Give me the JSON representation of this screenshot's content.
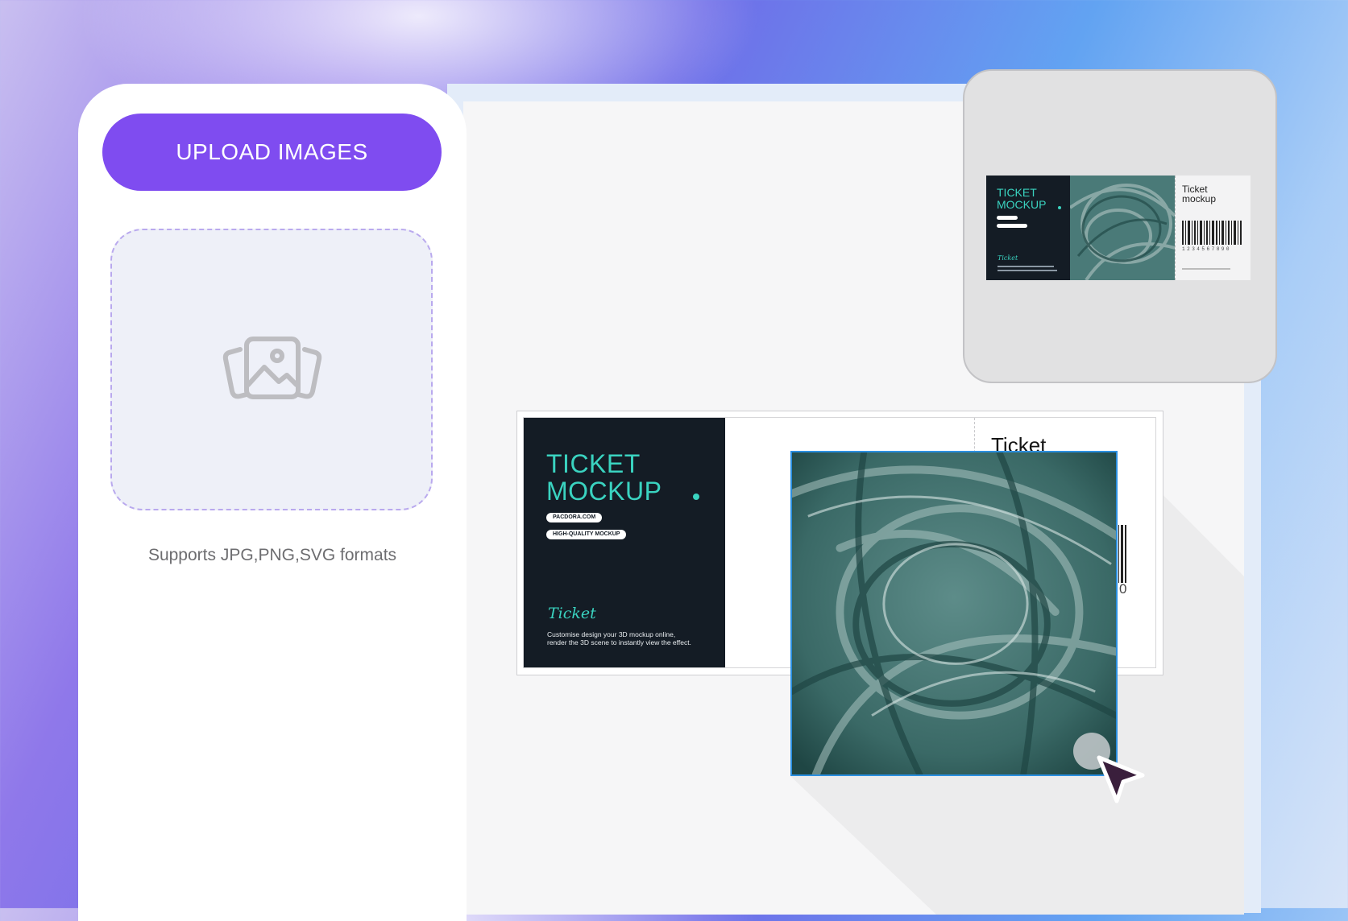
{
  "sidebar": {
    "upload_label": "UPLOAD IMAGES",
    "dropzone_icon": "image-gallery-icon",
    "formats_text": "Supports JPG,PNG,SVG formats"
  },
  "preview": {
    "ticket": {
      "title_line1": "TICKET",
      "title_line2": "MOCKUP",
      "script": "Ticket",
      "stub_title_line1": "Ticket",
      "stub_title_line2": "mockup",
      "barcode_digits": "1234567890"
    }
  },
  "ticket": {
    "title_line1": "TICKET",
    "title_line2": "MOCKUP",
    "pill1": "PACDORA.COM",
    "pill2": "HIGH-QUALITY MOCKUP",
    "script": "Ticket",
    "desc_line1": "Customise design your 3D mockup online,",
    "desc_line2": "render the 3D scene to instantly view the effect.",
    "stub_title": "Ticket",
    "stub_digit": "0"
  },
  "colors": {
    "accent": "#7f4cf0",
    "ticket_dark": "#141c25",
    "ticket_teal": "#3ad3c0",
    "selection": "#2b8fe0",
    "image_teal": "#3a6966"
  },
  "icons": {
    "cursor": "pointer-arrow-icon",
    "resize": "resize-handle"
  }
}
